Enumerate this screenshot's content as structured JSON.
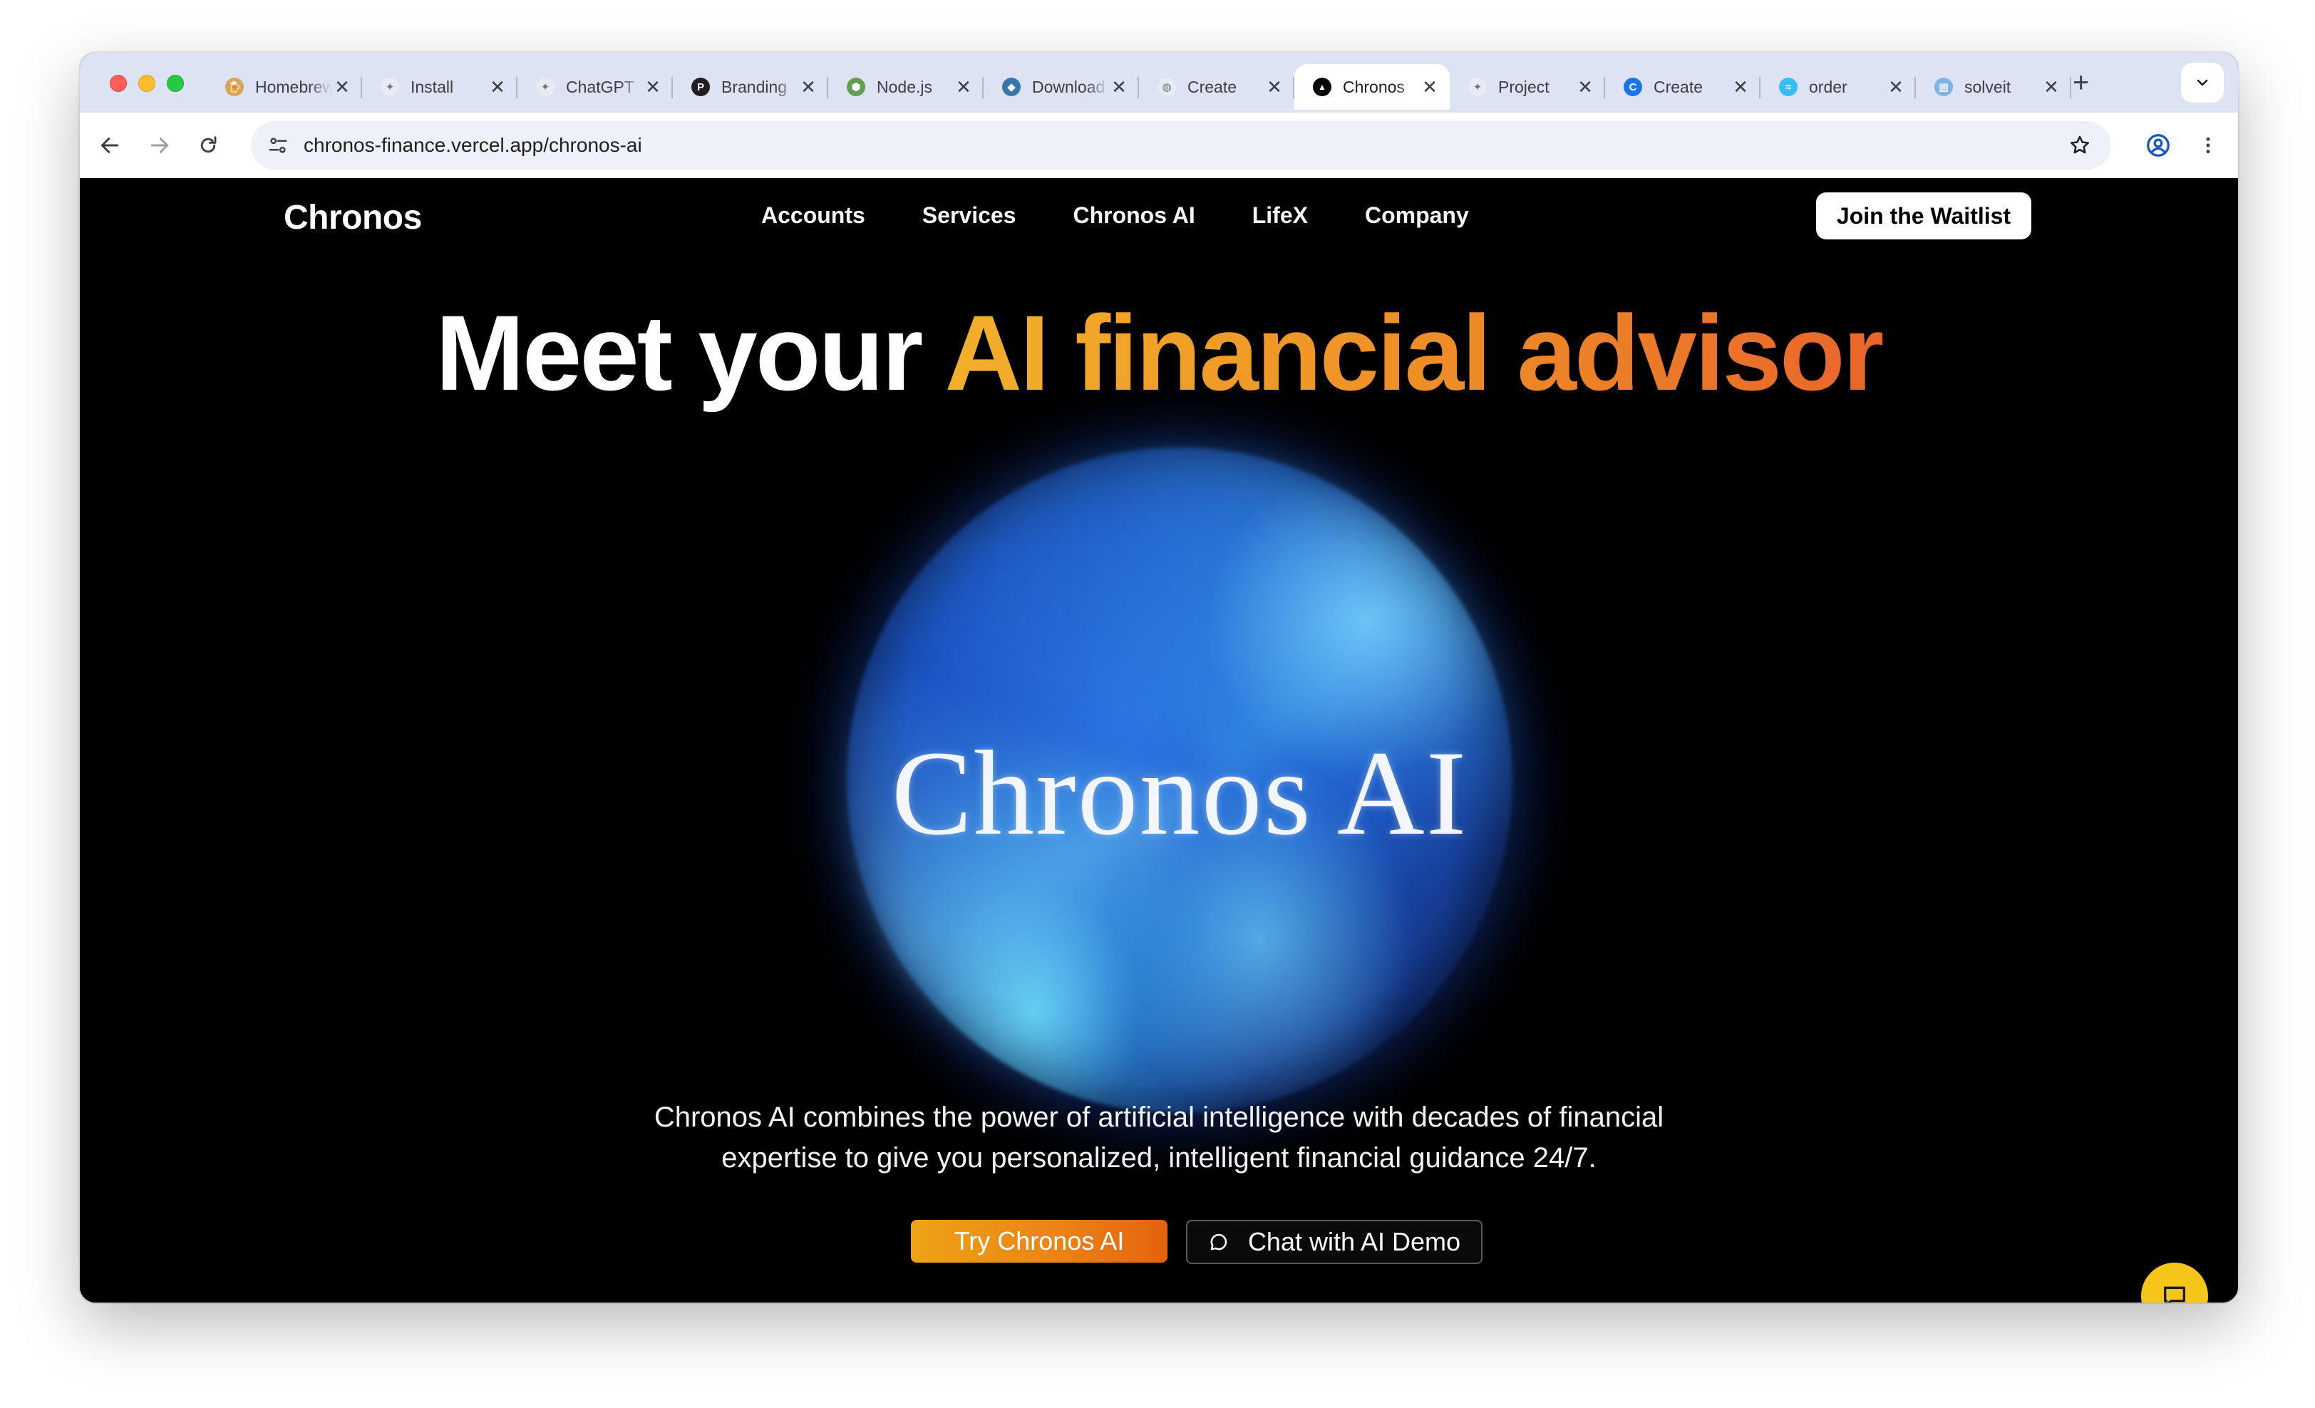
{
  "browser": {
    "tabs": [
      {
        "title": "Homebrew",
        "icon": "homebrew-icon",
        "color": "#d8a35a"
      },
      {
        "title": "Install",
        "icon": "openai-icon",
        "color": "#c8ccd6"
      },
      {
        "title": "ChatGPT",
        "icon": "openai-icon",
        "color": "#c8ccd6"
      },
      {
        "title": "Branding",
        "icon": "p-logo-icon",
        "color": "#1f1f1f"
      },
      {
        "title": "Node.js",
        "icon": "nodejs-icon",
        "color": "#5fa04e"
      },
      {
        "title": "Download",
        "icon": "python-icon",
        "color": "#3776ab"
      },
      {
        "title": "Create",
        "icon": "globe-icon",
        "color": "#9aa0a6"
      },
      {
        "title": "Chronos",
        "icon": "vercel-icon",
        "color": "#000000",
        "active": true
      },
      {
        "title": "Project",
        "icon": "openai-icon",
        "color": "#c8ccd6"
      },
      {
        "title": "Create",
        "icon": "c-logo-icon",
        "color": "#1a73e8"
      },
      {
        "title": "order",
        "icon": "tailwind-icon",
        "color": "#38bdf8"
      },
      {
        "title": "solveit",
        "icon": "app-icon",
        "color": "#7fb2e5"
      }
    ],
    "close_glyph": "✕",
    "new_tab_glyph": "+",
    "url": "chronos-finance.vercel.app/chronos-ai"
  },
  "site": {
    "brand": "Chronos",
    "nav": [
      "Accounts",
      "Services",
      "Chronos AI",
      "LifeX",
      "Company"
    ],
    "waitlist_label": "Join the Waitlist"
  },
  "hero": {
    "title_plain": "Meet your ",
    "title_highlight": "AI financial advisor",
    "orb_text": "Chronos AI",
    "description_line1": "Chronos AI combines the power of artificial intelligence with decades of financial",
    "description_line2": "expertise to give you personalized, intelligent financial guidance 24/7.",
    "primary_cta": "Try Chronos AI",
    "secondary_cta": "Chat with AI Demo"
  },
  "colors": {
    "accent_start": "#f2b02a",
    "accent_end": "#e8652a",
    "chat_fab": "#f5c518"
  }
}
